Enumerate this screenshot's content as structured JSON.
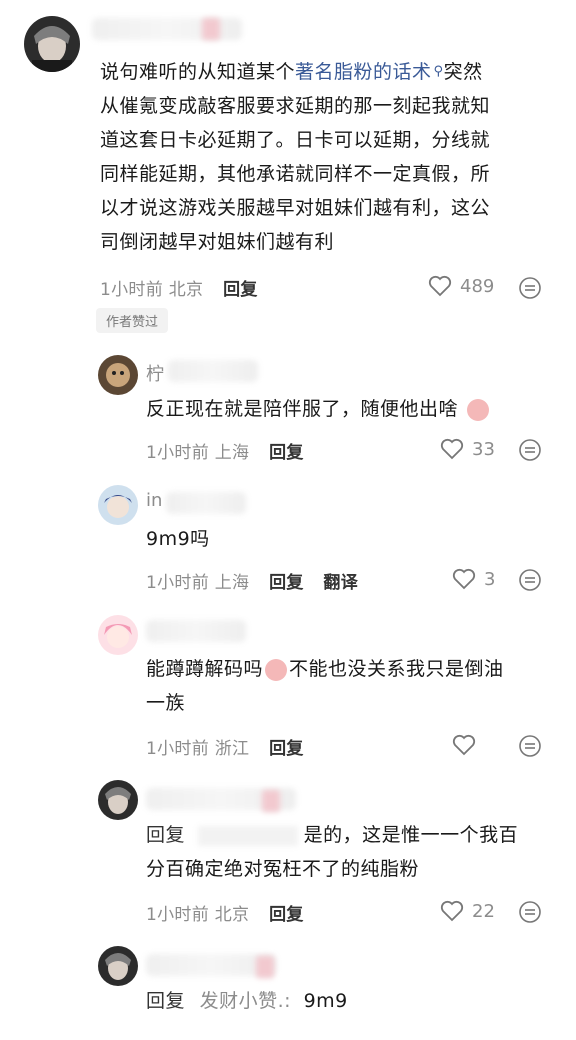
{
  "comments": [
    {
      "text_prefix": "说句难听的从知道某个",
      "link_text": "著名脂粉的话术",
      "text_line1_suffix": "突然",
      "text_lines": [
        "从催氪变成敲客服要求延期的那一刻起我就知",
        "道这套日卡必延期了。日卡可以延期，分线就",
        "同样能延期，其他承诺就同样不一定真假，所",
        "以才说这游戏关服越早对姐妹们越有利，这公",
        "司倒闭越早对姐妹们越有利"
      ],
      "time": "1小时前",
      "location": "北京",
      "reply_label": "回复",
      "likes": "489",
      "badge": "作者赞过"
    },
    {
      "name_visible": "柠",
      "text": "反正现在就是陪伴服了，随便他出啥",
      "time": "1小时前",
      "location": "上海",
      "reply_label": "回复",
      "likes": "33"
    },
    {
      "name_visible": "in",
      "text": "9m9吗",
      "time": "1小时前",
      "location": "上海",
      "reply_label": "回复",
      "translate_label": "翻译",
      "likes": "3"
    },
    {
      "text_line1": "能蹲蹲解码吗",
      "text_line1_b": "不能也没关系我只是倒油",
      "text_line2": "一族",
      "time": "1小时前",
      "location": "浙江",
      "reply_label": "回复",
      "likes": ""
    },
    {
      "reply_prefix": "回复",
      "text_line1_suffix": "是的，这是惟一一个我百",
      "text_line2": "分百确定绝对冤枉不了的纯脂粉",
      "time": "1小时前",
      "location": "北京",
      "reply_label": "回复",
      "likes": "22"
    },
    {
      "reply_prefix": "回复",
      "reply_target": "发财小赞.:",
      "text": "9m9"
    }
  ],
  "icons": {
    "heart": "heart-icon",
    "more": "more-options-icon",
    "search": "search-icon",
    "emoji": "emoji-icon"
  }
}
